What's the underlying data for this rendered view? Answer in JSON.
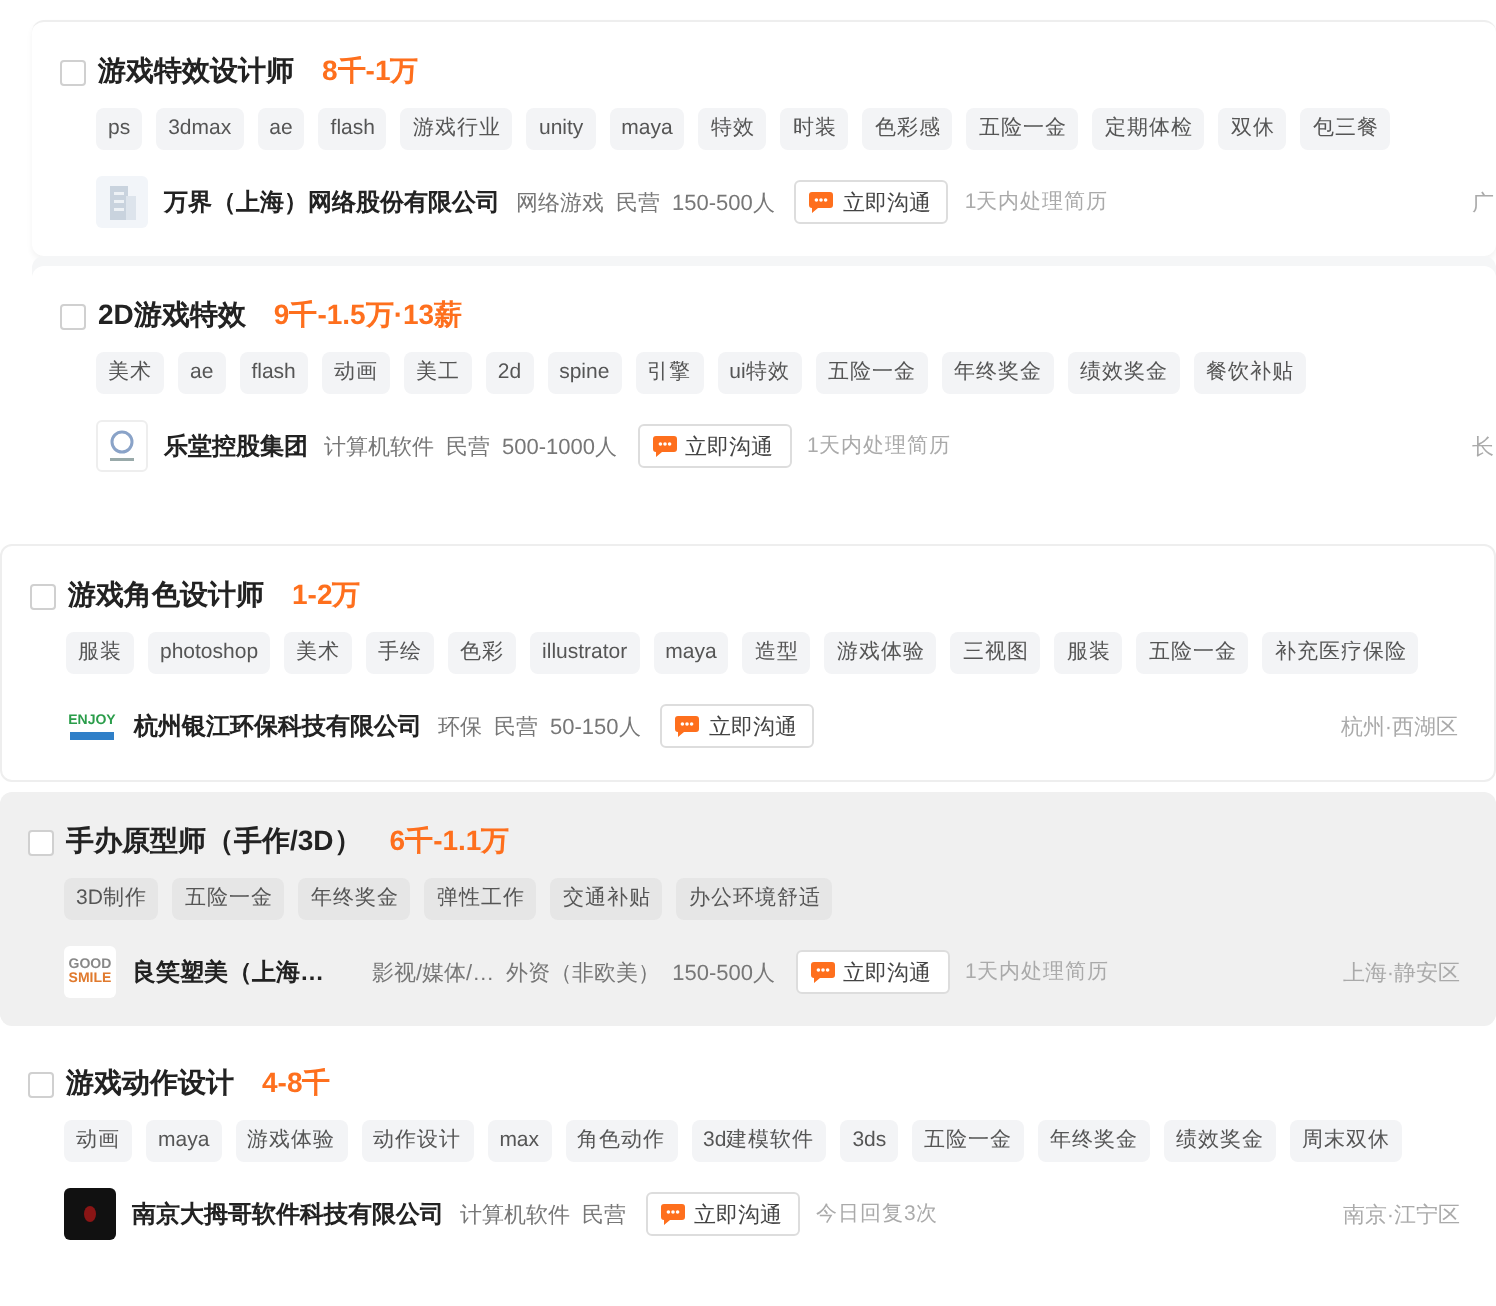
{
  "jobs": [
    {
      "checked": false,
      "selected": false,
      "title": "游戏特效设计师",
      "salary": "8千-1万",
      "tags": [
        "ps",
        "3dmax",
        "ae",
        "flash",
        "游戏行业",
        "unity",
        "maya",
        "特效",
        "时装",
        "色彩感",
        "五险一金",
        "定期体检",
        "双休",
        "包三餐"
      ],
      "logo": {
        "kind": "building"
      },
      "company": "万界（上海）网络股份有限公司",
      "meta": [
        "网络游戏",
        "民营",
        "150-500人"
      ],
      "contact_button": "立即沟通",
      "reply_note": "1天内处理简历",
      "location": "广"
    },
    {
      "checked": false,
      "selected": false,
      "title": "2D游戏特效",
      "salary": "9千-1.5万·13薪",
      "tags": [
        "美术",
        "ae",
        "flash",
        "动画",
        "美工",
        "2d",
        "spine",
        "引擎",
        "ui特效",
        "五险一金",
        "年终奖金",
        "绩效奖金",
        "餐饮补贴"
      ],
      "logo": {
        "kind": "emblem"
      },
      "company": "乐堂控股集团",
      "meta": [
        "计算机软件",
        "民营",
        "500-1000人"
      ],
      "contact_button": "立即沟通",
      "reply_note": "1天内处理简历",
      "location": "长"
    },
    {
      "checked": false,
      "selected": false,
      "title": "游戏角色设计师",
      "salary": "1-2万",
      "tags": [
        "服装",
        "photoshop",
        "美术",
        "手绘",
        "色彩",
        "illustrator",
        "maya",
        "造型",
        "游戏体验",
        "三视图",
        "服装",
        "五险一金",
        "补充医疗保险"
      ],
      "logo": {
        "kind": "wordmark",
        "text": [
          "ENJOY"
        ]
      },
      "company": "杭州银江环保科技有限公司",
      "meta": [
        "环保",
        "民营",
        "50-150人"
      ],
      "contact_button": "立即沟通",
      "location": "杭州·西湖区"
    },
    {
      "checked": false,
      "selected": true,
      "title": "手办原型师（手作/3D）",
      "salary": "6千-1.1万",
      "tags": [
        "3D制作",
        "五险一金",
        "年终奖金",
        "弹性工作",
        "交通补贴",
        "办公环境舒适"
      ],
      "logo": {
        "kind": "wordmark",
        "text": [
          "GOOD",
          "SMILE"
        ]
      },
      "company": "良笑塑美（上海…",
      "meta": [
        "影视/媒体/…",
        "外资（非欧美）",
        "150-500人"
      ],
      "contact_button": "立即沟通",
      "reply_note": "1天内处理简历",
      "location": "上海·静安区"
    },
    {
      "checked": false,
      "selected": false,
      "title": "游戏动作设计",
      "salary": "4-8千",
      "tags": [
        "动画",
        "maya",
        "游戏体验",
        "动作设计",
        "max",
        "角色动作",
        "3d建模软件",
        "3ds",
        "五险一金",
        "年终奖金",
        "绩效奖金",
        "周末双休"
      ],
      "logo": {
        "kind": "dark"
      },
      "company": "南京大拇哥软件科技有限公司",
      "meta": [
        "计算机软件",
        "民营"
      ],
      "contact_button": "立即沟通",
      "reply_note": "今日回复3次",
      "location": "南京·江宁区"
    }
  ]
}
